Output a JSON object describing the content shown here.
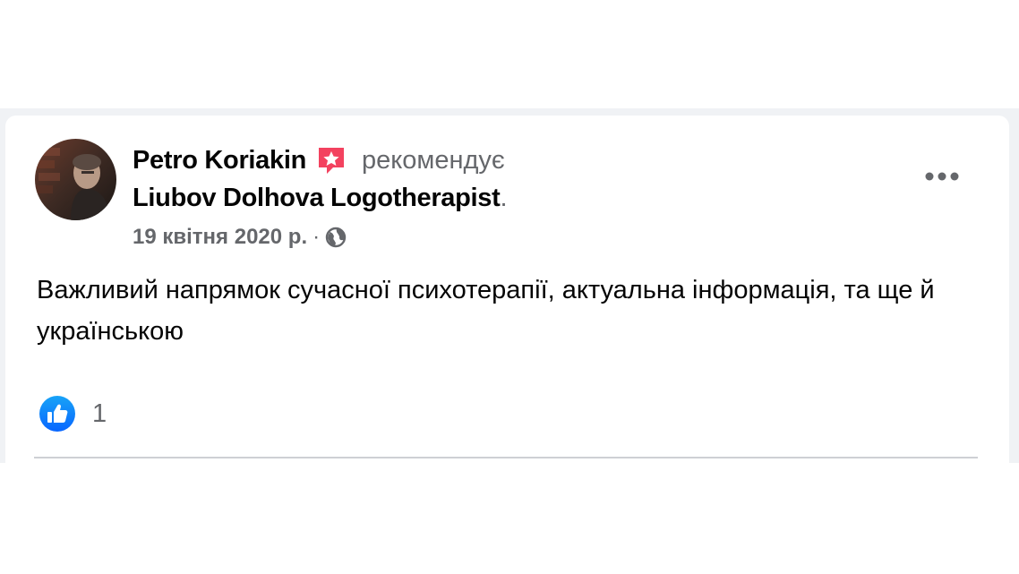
{
  "post": {
    "author": "Petro Koriakin",
    "action": "рекомендує",
    "page_name": "Liubov Dolhova Logotherapist",
    "page_suffix": ".",
    "date": "19 квітня 2020 р.",
    "separator": "·",
    "privacy_icon": "globe-icon",
    "recommendation_icon": "recommendation-star-icon",
    "text": "Важливий напрямок сучасної психотерапії, актуальна інформація, та ще й українською",
    "reaction_icon": "like-icon",
    "reaction_count": "1",
    "more_icon": "more-options-icon"
  },
  "colors": {
    "primary_text": "#050505",
    "secondary_text": "#65676b",
    "like_blue": "#1877f2",
    "recommend_pink": "#f3425f",
    "divider": "#ced0d4",
    "frame_bg": "#f0f2f5"
  }
}
